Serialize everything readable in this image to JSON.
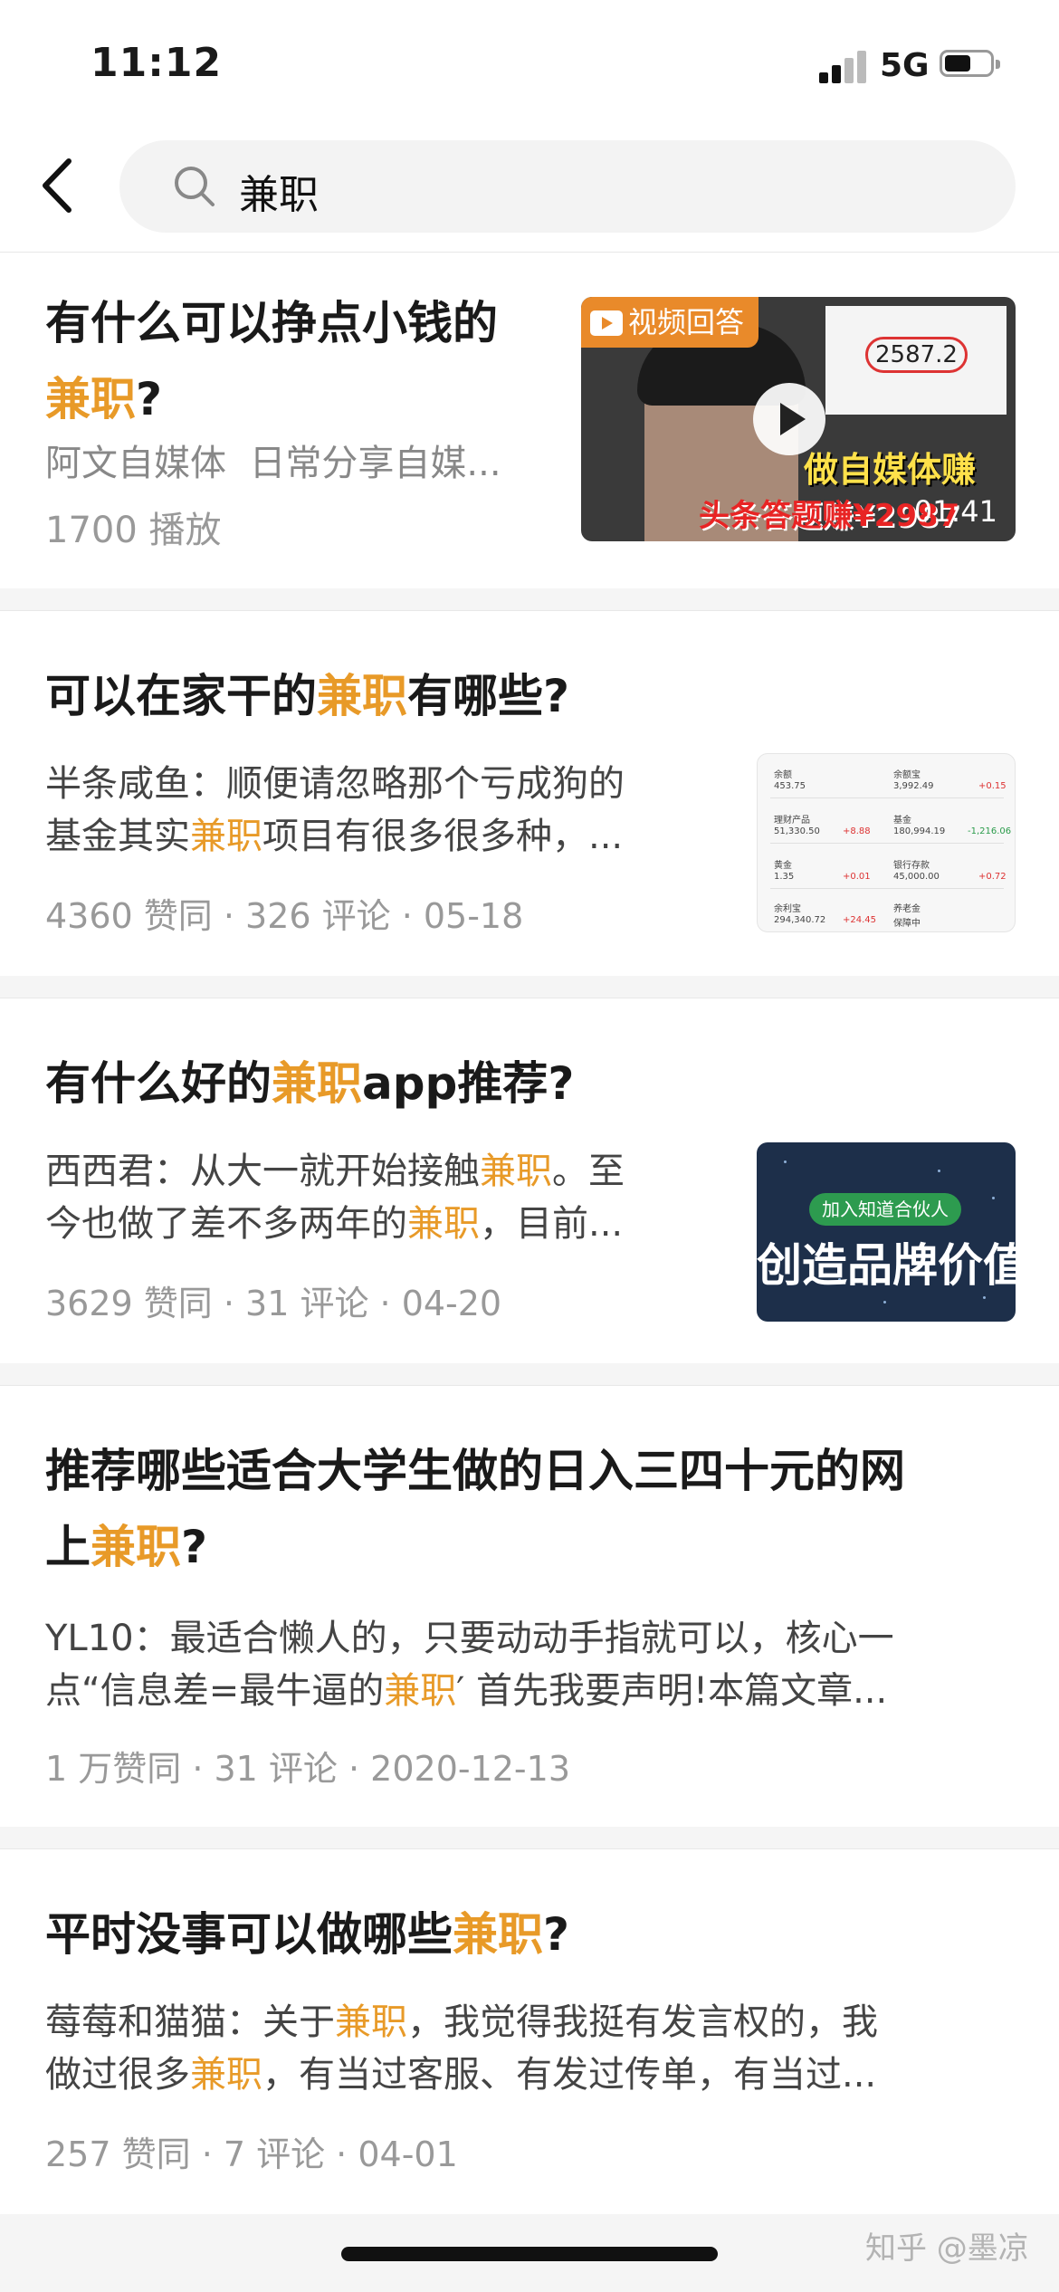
{
  "status_bar": {
    "time": "11:12",
    "network": "5G"
  },
  "search": {
    "query": "兼职"
  },
  "results": [
    {
      "title_pre": "有什么可以挣点小钱的",
      "title_hl": "兼职",
      "title_post": "?",
      "author": "阿文自媒体",
      "author_desc": "日常分享自媒...",
      "plays": "1700 播放",
      "video": {
        "badge": "视频回答",
        "paper_value": "2587.2",
        "caption1": "做自媒体赚",
        "caption2": "头条答题赚¥2987",
        "duration": "01:41"
      }
    },
    {
      "title_pre": "可以在家干的",
      "title_hl": "兼职",
      "title_post": "有哪些?",
      "excerpt_l1": "半条咸鱼：顺便请忽略那个亏成狗的",
      "excerpt_l2_pre": "基金其实",
      "excerpt_l2_hl": "兼职",
      "excerpt_l2_post": "项目有很多很多种，...",
      "meta": "4360 赞同 · 326 评论 · 05-18",
      "sheet": {
        "cells": [
          "余额",
          "余额宝",
          "453.75",
          "3,992.49",
          "+0.15",
          "理财产品",
          "基金",
          "51,330.50",
          "+8.88",
          "180,994.19",
          "-1,216.06",
          "黄金",
          "银行存款",
          "1.35",
          "+0.01",
          "45,000.00",
          "+0.72",
          "余利宝",
          "养老金",
          "294,340.72",
          "+24.45",
          "保障中"
        ]
      }
    },
    {
      "title_pre": "有什么好的",
      "title_hl": "兼职",
      "title_post": "app推荐?",
      "excerpt_l1_pre": "西西君：从大一就开始接触",
      "excerpt_l1_hl": "兼职",
      "excerpt_l1_post": "。至",
      "excerpt_l2_pre": "今也做了差不多两年的",
      "excerpt_l2_hl": "兼职",
      "excerpt_l2_post": "，目前...",
      "meta": "3629 赞同 · 31 评论 · 04-20",
      "promo": {
        "pill": "加入知道合伙人",
        "headline": "创造品牌价值"
      }
    },
    {
      "title_l1": "推荐哪些适合大学生做的日入三四十元的网",
      "title_l2_pre": "上",
      "title_l2_hl": "兼职",
      "title_l2_post": "?",
      "excerpt_l1": "YL10：最适合懒人的，只要动动手指就可以，核心一",
      "excerpt_l2_pre": "点“信息差=最牛逼的",
      "excerpt_l2_hl": "兼职",
      "excerpt_l2_post": "′ 首先我要声明!本篇文章...",
      "meta": "1 万赞同 · 31 评论 · 2020-12-13"
    },
    {
      "title_pre": "平时没事可以做哪些",
      "title_hl": "兼职",
      "title_post": "?",
      "excerpt_l1_pre": "莓莓和猫猫：关于",
      "excerpt_l1_hl": "兼职",
      "excerpt_l1_post": "，我觉得我挺有发言权的，我",
      "excerpt_l2_pre": "做过很多",
      "excerpt_l2_hl": "兼职",
      "excerpt_l2_post": "，有当过客服、有发过传单，有当过...",
      "meta": "257 赞同 · 7 评论 · 04-01"
    }
  ],
  "watermark": "知乎 @墨凉",
  "colors": {
    "highlight": "#e89a28",
    "meta": "#999999",
    "divider": "#f5f5f5"
  }
}
